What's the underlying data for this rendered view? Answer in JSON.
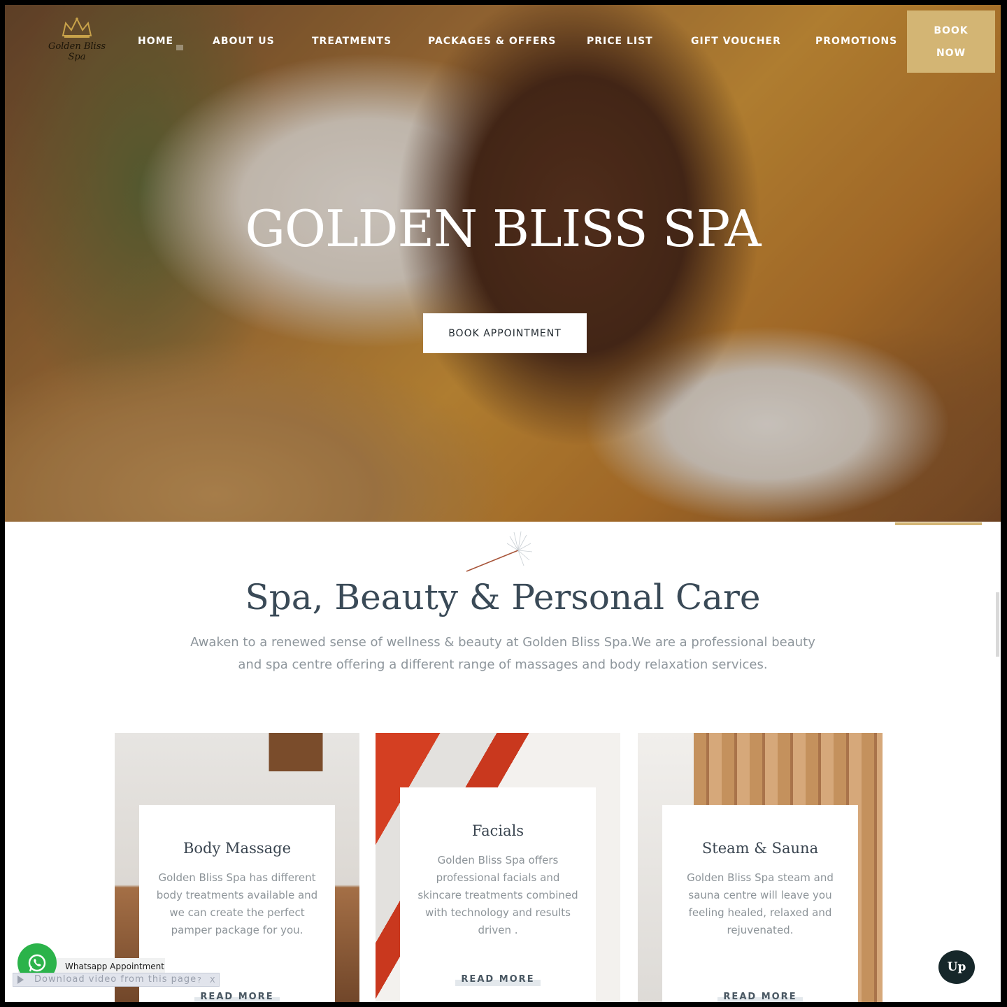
{
  "brand": {
    "name": "Golden Bliss Spa"
  },
  "nav": {
    "items": [
      {
        "label": "HOME"
      },
      {
        "label": "ABOUT US"
      },
      {
        "label": "TREATMENTS"
      },
      {
        "label": "PACKAGES & OFFERS"
      },
      {
        "label": "PRICE LIST"
      },
      {
        "label": "GIFT VOUCHER"
      },
      {
        "label": "PROMOTIONS"
      }
    ],
    "book_now": {
      "line1": "BOOK",
      "line2": "NOW"
    }
  },
  "hero": {
    "title": "GOLDEN BLISS SPA",
    "cta_label": "BOOK APPOINTMENT"
  },
  "intro": {
    "title": "Spa, Beauty & Personal Care",
    "text": "Awaken to a renewed sense of wellness & beauty at Golden Bliss Spa.We are a professional beauty and spa centre offering a different range of massages and body relaxation services."
  },
  "cards": [
    {
      "title": "Body Massage",
      "desc": "Golden Bliss Spa has different body treatments available and we can create the perfect pamper package for you.",
      "link": "READ MORE"
    },
    {
      "title": "Facials",
      "desc": "Golden Bliss Spa offers professional facials and skincare treatments combined with technology and results driven .",
      "link": "READ MORE"
    },
    {
      "title": "Steam & Sauna",
      "desc": "Golden Bliss Spa steam and sauna centre will leave you feeling healed, relaxed and rejuvenated.",
      "link": "READ MORE"
    }
  ],
  "widgets": {
    "whatsapp_label": "Whatsapp Appointment",
    "download_label": "Download video from this page",
    "download_help": "?",
    "download_close": "X",
    "up_label": "Up"
  },
  "colors": {
    "accent_gold": "#d3b574",
    "heading": "#3a4a57",
    "whatsapp": "#2bb34a",
    "up_button": "#16272a"
  }
}
